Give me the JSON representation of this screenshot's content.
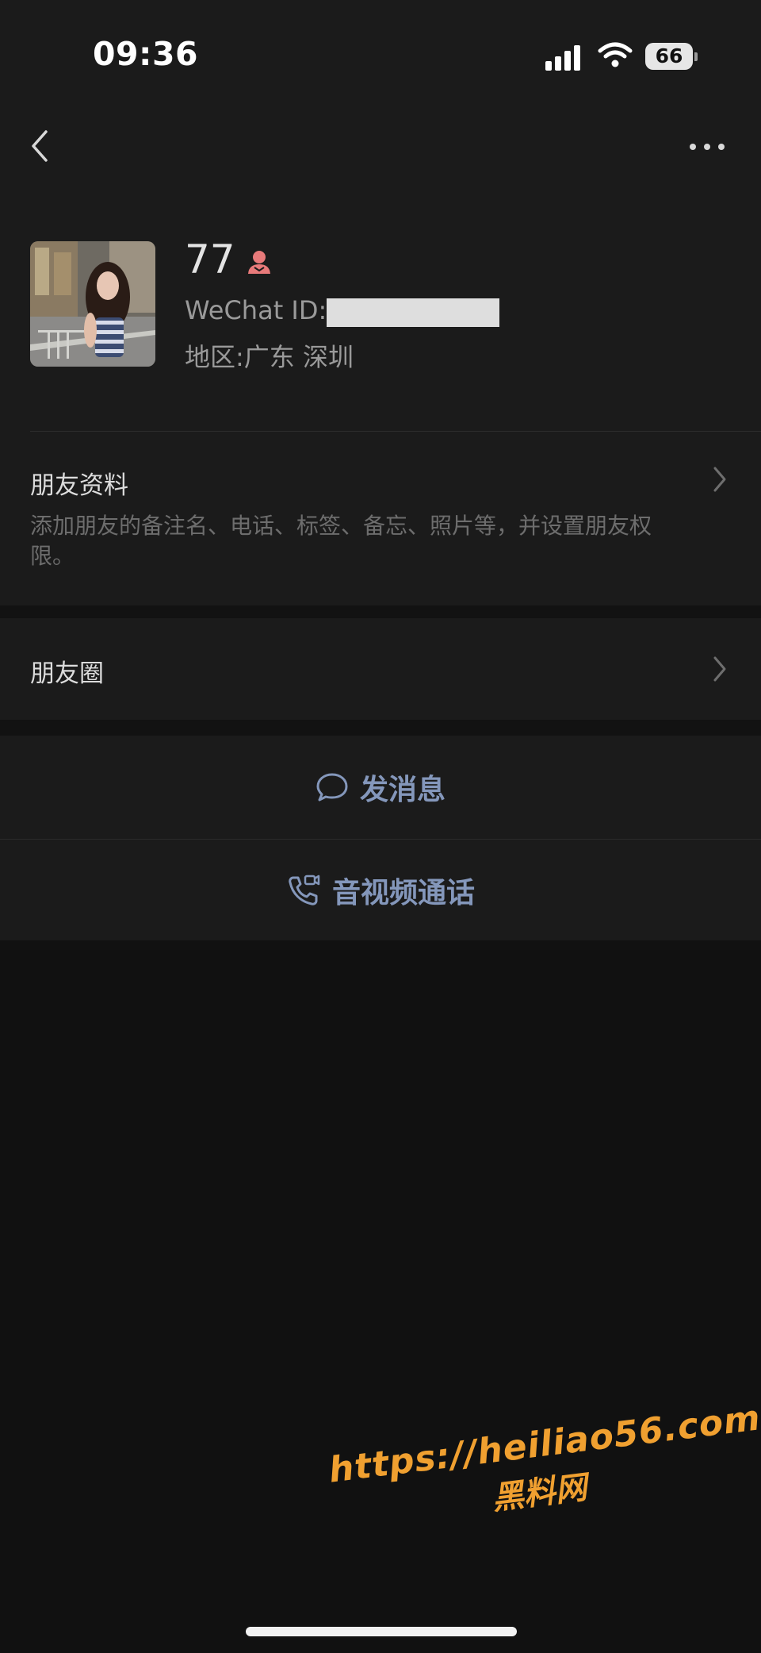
{
  "status_bar": {
    "time": "09:36",
    "battery": "66",
    "icons": [
      "signal-icon",
      "wifi-icon",
      "battery-icon"
    ]
  },
  "nav": {
    "back_icon": "chevron-left-icon",
    "more_icon": "more-dots-icon"
  },
  "profile": {
    "nickname": "77",
    "gender_icon": "female-icon",
    "wechat_id_label": "WeChat ID:",
    "region": "地区:广东 深圳"
  },
  "rows": {
    "friend_info": {
      "title": "朋友资料",
      "description": "添加朋友的备注名、电话、标签、备忘、照片等，并设置朋友权限。"
    },
    "moments": {
      "title": "朋友圈"
    }
  },
  "actions": {
    "message": {
      "label": "发消息",
      "icon": "chat-bubble-icon"
    },
    "call": {
      "label": "音视频通话",
      "icon": "phone-video-icon"
    }
  },
  "watermark": {
    "line1": "https://heiliao56.com",
    "line2": "黑料网"
  },
  "colors": {
    "background": "#111111",
    "panel": "#1b1b1b",
    "action_text": "#8497bb",
    "watermark": "#f0a030",
    "gender_icon": "#e87a7a"
  }
}
